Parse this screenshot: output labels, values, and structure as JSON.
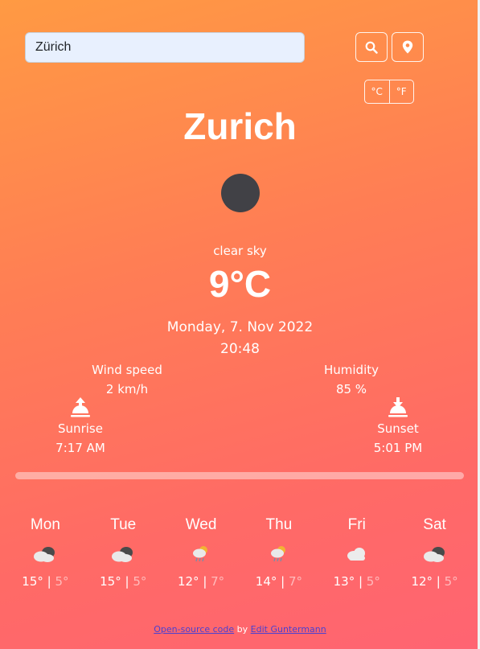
{
  "search": {
    "value": "Zürich"
  },
  "units": {
    "celsius": "°C",
    "fahrenheit": "°F"
  },
  "current": {
    "city": "Zurich",
    "icon": "clear-night-moon",
    "description": "clear sky",
    "temperature": "9°C",
    "date": "Monday, 7. Nov 2022",
    "time": "20:48"
  },
  "stats": {
    "wind_label": "Wind speed",
    "wind_value": "2 km/h",
    "humidity_label": "Humidity",
    "humidity_value": "85 %"
  },
  "sun": {
    "sunrise_label": "Sunrise",
    "sunrise_time": "7:17 AM",
    "sunset_label": "Sunset",
    "sunset_time": "5:01 PM"
  },
  "forecast": [
    {
      "day": "Mon",
      "icon": "cloudy-dark-icon",
      "high": "15°",
      "low": "5°"
    },
    {
      "day": "Tue",
      "icon": "cloudy-dark-icon",
      "high": "15°",
      "low": "5°"
    },
    {
      "day": "Wed",
      "icon": "sun-rain-icon",
      "high": "12°",
      "low": "7°"
    },
    {
      "day": "Thu",
      "icon": "sun-rain-icon",
      "high": "14°",
      "low": "7°"
    },
    {
      "day": "Fri",
      "icon": "cloud-icon",
      "high": "13°",
      "low": "5°"
    },
    {
      "day": "Sat",
      "icon": "cloudy-dark-icon",
      "high": "12°",
      "low": "5°"
    }
  ],
  "footer": {
    "link1": "Open-source code",
    "by": " by ",
    "link2": "Edit Guntermann"
  }
}
